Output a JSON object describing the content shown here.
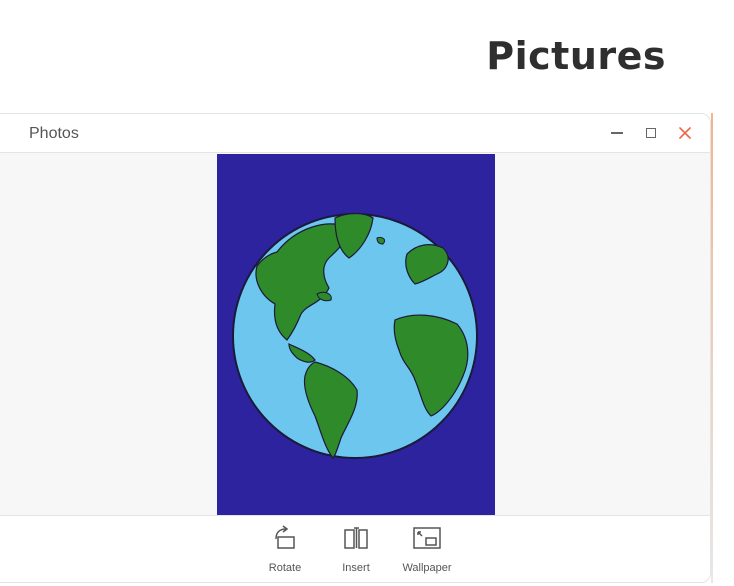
{
  "page": {
    "heading": "Pictures"
  },
  "window": {
    "title": "Photos",
    "controls": {
      "minimize_icon": "minimize-icon",
      "maximize_icon": "maximize-icon",
      "close_icon": "close-icon"
    }
  },
  "image": {
    "subject": "earth-drawing"
  },
  "toolbar": {
    "rotate_label": "Rotate",
    "insert_label": "Insert",
    "wallpaper_label": "Wallpaper"
  },
  "colors": {
    "close_accent": "#e8684a",
    "background_blue": "#2a1f9a",
    "ocean": "#6cc6ee",
    "land": "#2f8a2a"
  }
}
